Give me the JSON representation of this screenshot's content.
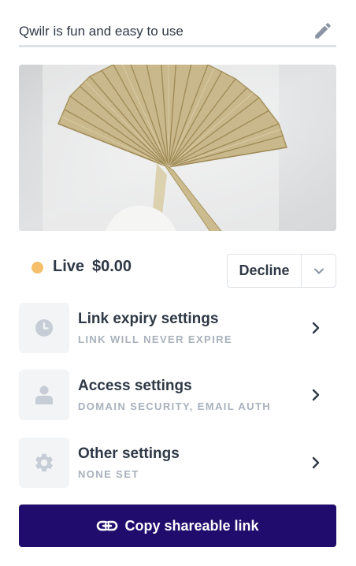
{
  "header": {
    "title": "Qwilr is fun and easy to use"
  },
  "cover": {
    "icon": "dried-palm-leaf-image"
  },
  "status": {
    "label": "Live",
    "amount": "$0.00",
    "dot_color": "#f6bf6a"
  },
  "actions": {
    "decline_label": "Decline"
  },
  "settings": [
    {
      "title": "Link expiry settings",
      "subtitle": "LINK WILL NEVER EXPIRE",
      "icon": "clock-icon"
    },
    {
      "title": "Access settings",
      "subtitle": "DOMAIN SECURITY, EMAIL AUTH",
      "icon": "person-icon"
    },
    {
      "title": "Other settings",
      "subtitle": "NONE SET",
      "icon": "gear-icon"
    }
  ],
  "footer": {
    "copy_label": "Copy shareable link",
    "button_color": "#200c6d"
  }
}
